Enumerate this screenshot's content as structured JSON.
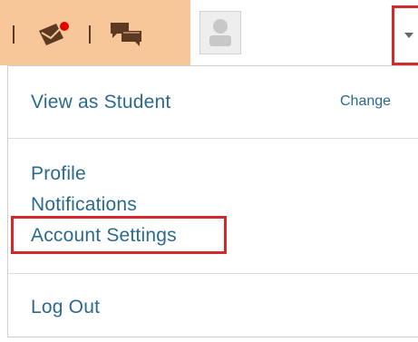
{
  "topbar": {
    "icons": [
      "message-notification-icon",
      "chat-icon",
      "avatar-placeholder-icon",
      "chevron-down-icon"
    ],
    "colors": {
      "icon_zone_bg": "#f7c79a",
      "alert_dot": "#e00000",
      "highlight": "#d22a2a",
      "link": "#2a6a8e"
    }
  },
  "menu": {
    "view_as_student": "View as Student",
    "change": "Change",
    "profile": "Profile",
    "notifications": "Notifications",
    "account_settings": "Account Settings",
    "log_out": "Log Out"
  }
}
